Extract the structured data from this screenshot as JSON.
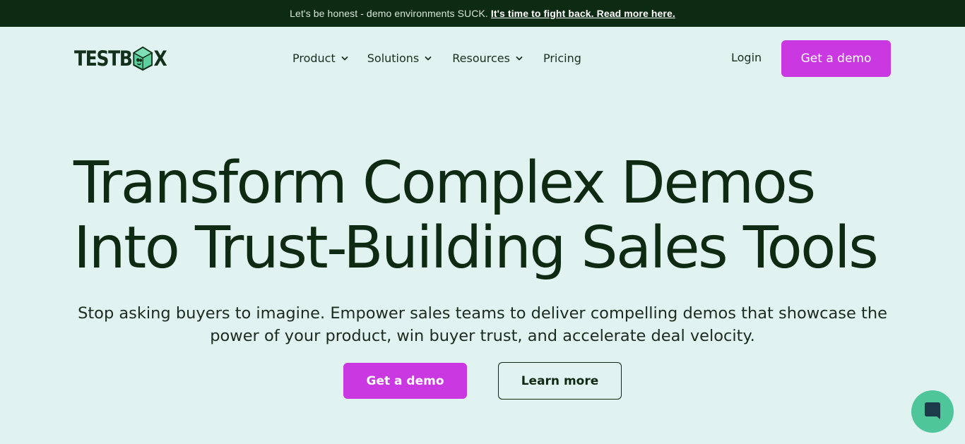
{
  "banner": {
    "message": "Let's be honest - demo environments SUCK.",
    "link": "It's time to fight back. Read more here."
  },
  "logo": {
    "text_left": "TESTB",
    "text_right": "X",
    "icon": "box-mascot-icon"
  },
  "nav": {
    "items": [
      {
        "label": "Product",
        "icon": "chevron-down-icon"
      },
      {
        "label": "Solutions",
        "icon": "chevron-down-icon"
      },
      {
        "label": "Resources",
        "icon": "chevron-down-icon"
      },
      {
        "label": "Pricing"
      }
    ],
    "login": "Login",
    "cta": "Get a demo"
  },
  "hero": {
    "title_line1": "Transform Complex Demos",
    "title_line2": "Into Trust-Building Sales Tools",
    "subtitle": "Stop asking buyers to imagine. Empower sales teams to deliver compelling demos that showcase the power of your product, win buyer trust, and accelerate deal velocity.",
    "primary_cta": "Get a demo",
    "secondary_cta": "Learn more"
  },
  "chat": {
    "icon": "chat-bubble-icon"
  },
  "colors": {
    "banner_bg": "#0d2a12",
    "page_bg": "#e1f3f0",
    "accent": "#c938e0",
    "text_dark": "#0f2a12",
    "chat_bg": "#4fc59a"
  }
}
